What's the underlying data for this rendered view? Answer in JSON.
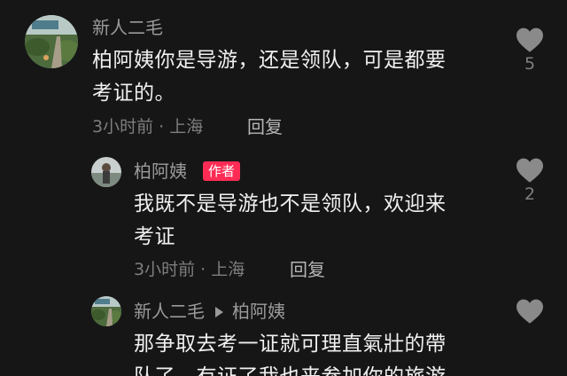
{
  "comments": [
    {
      "username": "新人二毛",
      "text_lines": [
        "柏阿姨你是导游，还是领队，可是都要",
        "考证的。"
      ],
      "time": "3小时前",
      "location": "上海",
      "reply_label": "回复",
      "like_count": "5"
    },
    {
      "username": "柏阿姨",
      "badge": "作者",
      "text_lines": [
        "我既不是导游也不是领队，欢迎来",
        "考证"
      ],
      "time": "3小时前",
      "location": "上海",
      "reply_label": "回复",
      "like_count": "2"
    },
    {
      "username": "新人二毛",
      "reply_to": "柏阿姨",
      "text_lines": [
        "那争取去考一证就可理直氣壯的帶",
        "队了，有证了我也来参加你的旅游"
      ]
    }
  ],
  "meta_separator": " · ",
  "colors": {
    "background": "#161616",
    "author_badge": "#fe2c55",
    "text": "#f0f0f0",
    "muted": "#7e7e7e"
  },
  "icons": {
    "like": "heart-icon",
    "reply_arrow": "triangle-right-icon"
  }
}
